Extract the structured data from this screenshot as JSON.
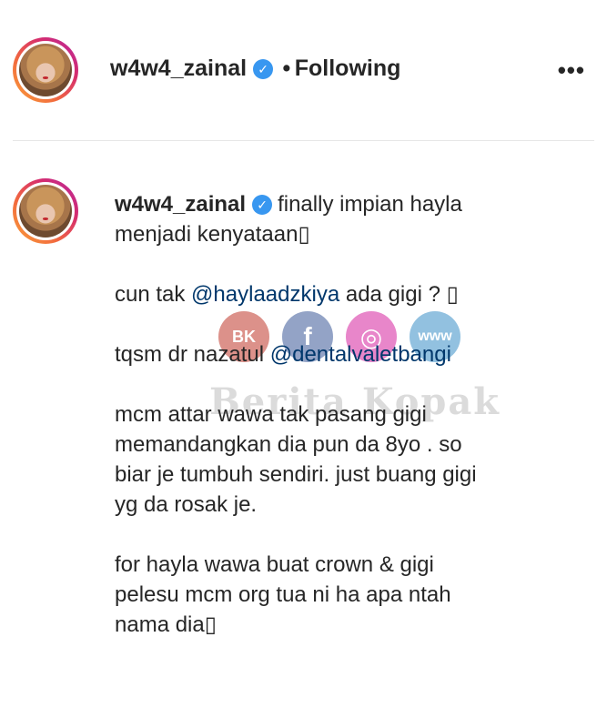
{
  "header": {
    "username": "w4w4_zainal",
    "separator": "•",
    "following_label": "Following",
    "more_label": "•••"
  },
  "post": {
    "username": "w4w4_zainal",
    "caption_lead": "finally impian hayla",
    "caption_line2": "menjadi kenyataan▯",
    "para2_before": "cun tak ",
    "para2_mention": "@haylaadzkiya",
    "para2_after": " ada gigi ? ▯",
    "para3_before": "tqsm dr nazatul ",
    "para3_mention": "@dentalvaletbangi",
    "para4_line1": "mcm attar wawa tak pasang gigi",
    "para4_line2": "memandangkan dia pun da 8yo . so",
    "para4_line3": "biar je tumbuh sendiri. just buang gigi",
    "para4_line4": "yg da rosak je.",
    "para5_line1": "for hayla wawa buat crown & gigi",
    "para5_line2": "pelesu mcm org tua ni ha apa ntah",
    "para5_line3": "nama dia▯"
  },
  "watermark": {
    "text": "Berita Kopak",
    "badge": "BK",
    "fb_glyph": "f",
    "ig_glyph": "◎",
    "web_glyph": "www"
  },
  "colors": {
    "verified": "#3897f0",
    "mention": "#00376b",
    "text": "#262626"
  },
  "icons": [
    "verified-badge-icon",
    "more-options-icon",
    "facebook-icon",
    "instagram-icon",
    "globe-icon"
  ]
}
